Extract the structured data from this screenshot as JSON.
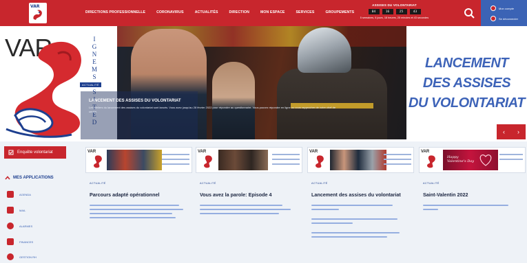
{
  "header": {
    "logo_text": "VAR",
    "nav": [
      "DIRECTIONS PROFESSIONNELLE",
      "CORONAVIRUS",
      "ACTUALITÉS",
      "DIRECTION",
      "MON ESPACE",
      "SERVICES",
      "GROUPEMENTS"
    ],
    "countdown": {
      "title": "ASSISES DU VOLONTARIAT",
      "blocks": [
        "04",
        "16",
        "25",
        "43"
      ],
      "text": "5 semaines, 6 jours, 18 heures, 25 minutes et 43 secondes"
    },
    "account": [
      {
        "label": "Mon compte"
      },
      {
        "label": "Se déconnecter"
      }
    ]
  },
  "hero": {
    "logo_text": "VAR",
    "vertical_letters": [
      "I",
      "G",
      "N",
      "E",
      "M",
      "S",
      "",
      "S",
      "I",
      "T",
      "E",
      "D"
    ],
    "tag": "ACTUALITÉ",
    "title": "LANCEMENT DES ASSISES DU VOLONTARIAT",
    "description": "Les ateliers du lancement des assises du volontariat sont lancés. Vous avez jusqu'au 28 février 2022 pour répondre au questionnaire. Vous pouvez répondre en ligne ou vous rapprocher de votre chef de centre.",
    "headline": [
      "LANCEMENT",
      "DES ASSISES",
      "DU VOLONTARIAT"
    ],
    "prev": "‹",
    "next": "›"
  },
  "sidebar": {
    "enquete_label": "Enquête volontariat",
    "apps_heading": "MES APPLICATIONS",
    "apps": [
      {
        "label": "AGENDA",
        "icon": "calendar-icon"
      },
      {
        "label": "MAIL",
        "icon": "mail-icon"
      },
      {
        "label": "ALARMES",
        "icon": "alarm-icon"
      },
      {
        "label": "FINANCES",
        "icon": "edit-icon"
      },
      {
        "label": "GESTION RH",
        "icon": "person-icon"
      }
    ]
  },
  "cards": [
    {
      "category": "ACTUALITÉ",
      "title": "Parcours adapté opérationnel",
      "thumb_logo": "VAR"
    },
    {
      "category": "ACTUALITÉ",
      "title": "Vous avez la parole: Episode 4",
      "thumb_logo": "VAR"
    },
    {
      "category": "ACTUALITÉ",
      "title": "Lancement des assises du volontariat",
      "thumb_logo": "VAR"
    },
    {
      "category": "ACTUALITÉ",
      "title": "Saint-Valentin 2022",
      "thumb_logo": "VAR",
      "thumb_caption": "Happy Valentine's Day"
    }
  ],
  "colors": {
    "brand_red": "#c8262d",
    "brand_blue": "#1d3f8f",
    "accent_blue": "#3d63b8"
  }
}
